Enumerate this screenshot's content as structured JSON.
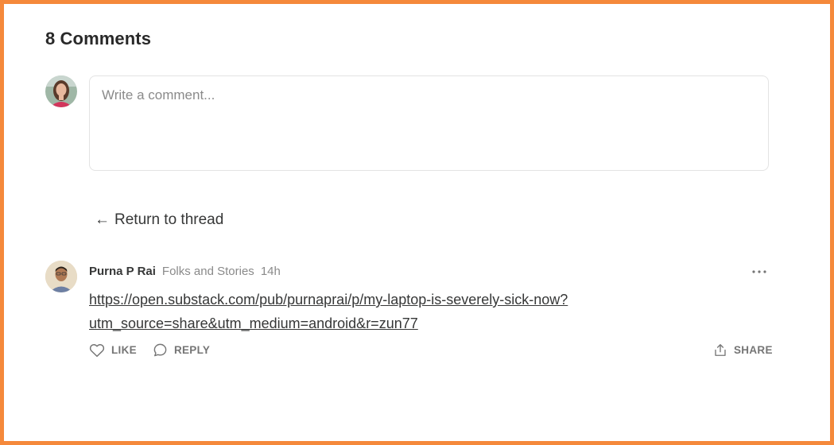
{
  "comments_section": {
    "heading": "8 Comments",
    "composer": {
      "placeholder": "Write a comment..."
    },
    "return_link": {
      "arrow": "←",
      "label": "Return to thread"
    }
  },
  "comment": {
    "author": "Purna P Rai",
    "publication": "Folks and Stories",
    "time_ago": "14h",
    "link_line_1": "https://open.substack.com/pub/purnaprai/p/my-laptop-is-severely-sick-now?",
    "link_line_2": "utm_source=share&utm_medium=android&r=zun77",
    "actions": {
      "like": "LIKE",
      "reply": "REPLY",
      "share": "SHARE"
    }
  },
  "colors": {
    "frame_border": "#f5893b",
    "text": "#363737",
    "muted": "#8a8a8a",
    "action": "#757575"
  }
}
